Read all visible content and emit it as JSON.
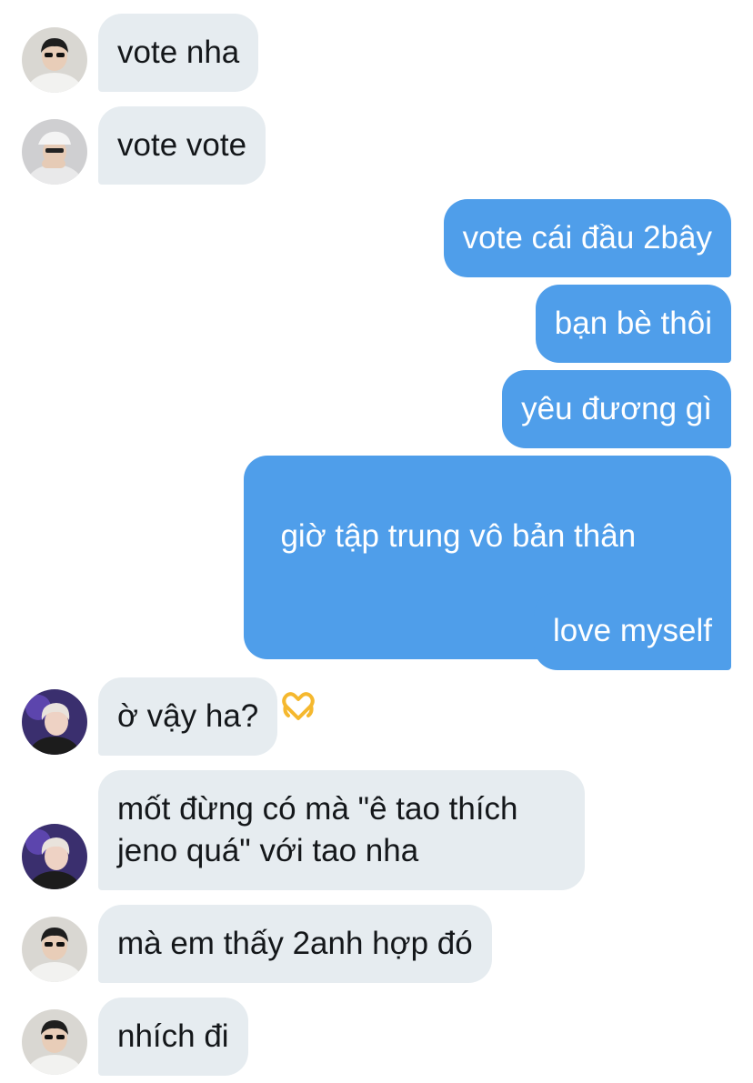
{
  "messages": [
    {
      "side": "in",
      "avatar": "avatar-a",
      "text": "vote nha"
    },
    {
      "side": "in",
      "avatar": "avatar-b",
      "text": "vote vote"
    },
    {
      "side": "out",
      "text": "vote cái đầu 2bây"
    },
    {
      "side": "out",
      "text": "bạn bè thôi"
    },
    {
      "side": "out",
      "text": "yêu đương gì"
    },
    {
      "side": "out",
      "text": "giờ tập trung vô bản thân",
      "emoji": "heart-hands-emoji"
    },
    {
      "side": "out",
      "text": "love myself"
    },
    {
      "side": "in",
      "avatar": "avatar-c",
      "text": "ờ vậy ha?"
    },
    {
      "side": "in",
      "avatar": "avatar-c",
      "text": "mốt đừng có mà \"ê tao thích jeno quá\" với tao nha"
    },
    {
      "side": "in",
      "avatar": "avatar-a",
      "text": "mà em thấy 2anh hợp đó"
    },
    {
      "side": "in",
      "avatar": "avatar-a",
      "text": "nhích đi"
    }
  ],
  "colors": {
    "incoming": "#e6ecf0",
    "outgoing": "#4f9eea",
    "incoming_text": "#14171a",
    "outgoing_text": "#ffffff"
  }
}
